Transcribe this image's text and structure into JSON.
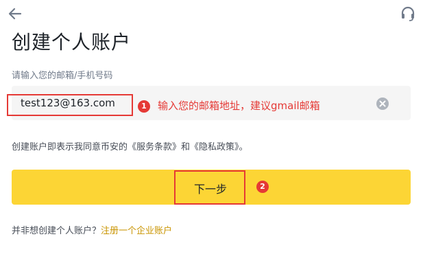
{
  "header": {
    "back_icon": "arrow-left-icon",
    "support_icon": "headset-icon"
  },
  "page_title": "创建个人账户",
  "email_field": {
    "label": "请输入您的邮箱/手机号码",
    "value": "test123@163.com",
    "clear_icon": "clear-circle-icon"
  },
  "annotations": {
    "step1_badge": "1",
    "step1_note": "输入您的邮箱地址，建议gmail邮箱",
    "step2_badge": "2",
    "highlight_color": "#e53935"
  },
  "terms_text": "创建账户即表示我同意币安的《服务条款》和《隐私政策》。",
  "next_button": {
    "label": "下一步",
    "color": "#fcd535"
  },
  "footer": {
    "prompt": "并非想创建个人账户？",
    "link": "注册一个企业账户",
    "link_color": "#c99400"
  }
}
